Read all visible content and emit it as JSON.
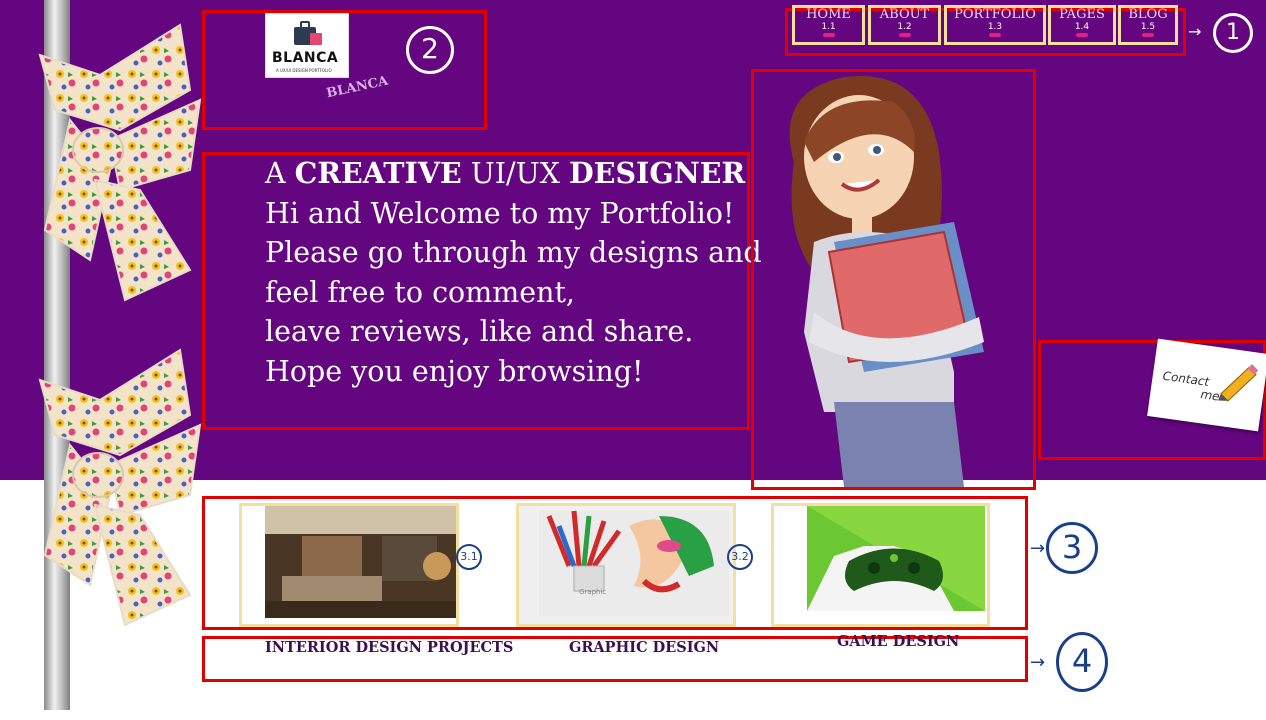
{
  "nav": {
    "items": [
      {
        "label": "HOME",
        "num": "1.1"
      },
      {
        "label": "ABOUT",
        "num": "1.2"
      },
      {
        "label": "PORTFOLIO",
        "num": "1.3"
      },
      {
        "label": "PAGES",
        "num": "1.4"
      },
      {
        "label": "BLOG",
        "num": "1.5"
      }
    ],
    "annotation": "1"
  },
  "logo": {
    "word": "BLANCA",
    "tagline": "A UX/UI DESIGN PORTFOLIO",
    "subtitle": "BLANCA",
    "annotation": "2"
  },
  "intro": {
    "line1_a": "A ",
    "line1_b": "CREATIVE",
    "line1_c": " UI/UX ",
    "line1_d": "DESIGNER",
    "line2": "Hi and Welcome to my Portfolio!",
    "line3": "Please go through my designs and",
    "line4": "feel free to comment,",
    "line5": "leave reviews, like and share.",
    "line6": "Hope you enjoy browsing!"
  },
  "contact": {
    "label_1": "Contact",
    "label_2": "me"
  },
  "thumbs": {
    "annotation": "3",
    "items": [
      {
        "annot": "3.1"
      },
      {
        "annot": "3.2"
      },
      {
        "annot": ""
      }
    ],
    "graphic_label": "Graphic"
  },
  "captions": {
    "annotation": "4",
    "items": [
      "INTERIOR DESIGN PROJECTS",
      "GRAPHIC DESIGN",
      "GAME DESIGN"
    ]
  },
  "colors": {
    "hero_bg": "#650681",
    "annotation_red": "#e00000",
    "annotation_yellow": "#f2e0a0",
    "annotation_blue": "#1a3f8a",
    "caption_text": "#3a1050"
  }
}
